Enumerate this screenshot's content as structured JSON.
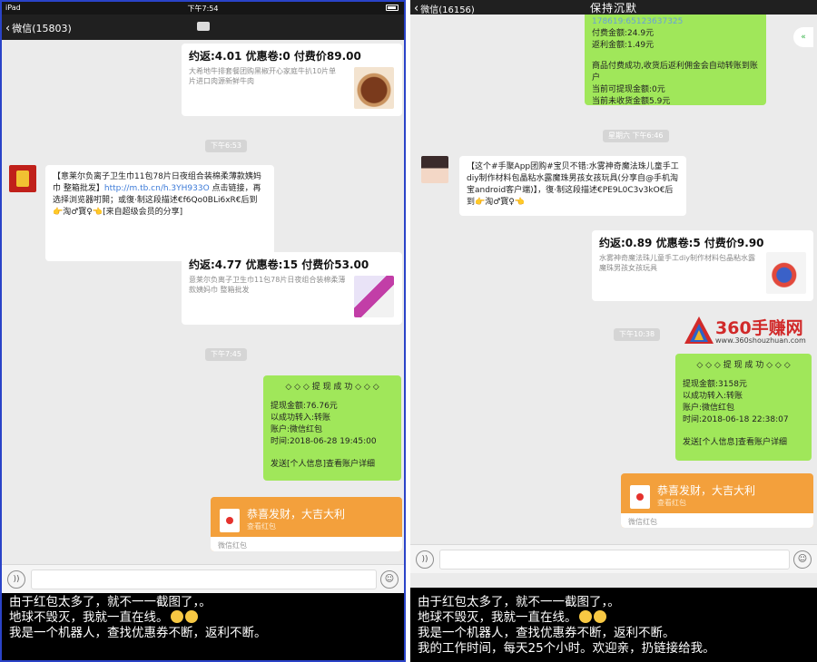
{
  "left": {
    "status": {
      "device": "iPad",
      "time": "下午7:54"
    },
    "nav": {
      "back_label": "微信(15803)"
    },
    "times": [
      "下午6:53",
      "下午7:45"
    ],
    "deal1": {
      "title": "约返:4.01 优惠卷:0 付费价89.00",
      "desc": "大希地牛排套餐团购黑椒开心家庭牛扒10片单片进口肉源新鲜牛肉"
    },
    "share1": {
      "text_a": "【意莱尔负离子卫生巾11包78片日夜组合装棉柔薄款姨妈巾 整箱批发】",
      "link": "http://m.tb.cn/h.3YH933O",
      "text_b": " 点击链接，再选择浏览器咑閞；或復·制这段描述€f6Qo0BLi6xR€后到👉淘♂寳♀👈[来自超级会员的分享]"
    },
    "deal2": {
      "title": "约返:4.77 优惠卷:15 付费价53.00",
      "desc": "意莱尔负离子卫生巾11包78片日夜组合装棉柔薄款姨妈巾 整箱批发"
    },
    "withdraw": {
      "header": "◇ ◇ ◇ 提 现 成 功 ◇ ◇ ◇",
      "amount": "提现金额:76.76元",
      "to": "以成功转入:转账",
      "account": "账户:微信红包",
      "time": "时间:2018-06-28 19:45:00",
      "footer": "发送[个人信息]查看账户详细"
    },
    "redpacket": {
      "title": "恭喜发财，大吉大利",
      "sub": "查看红包",
      "footer": "微信红包"
    },
    "caption": {
      "line1": "由于红包太多了，就不一一截图了，。",
      "line2": "地球不毁灭，我就一直在线。",
      "line3": "我是一个机器人，查找优惠券不断，返利不断。"
    }
  },
  "right": {
    "nav": {
      "back_label": "微信(16156)",
      "title": "保持沉默"
    },
    "side_badge": "«",
    "green_top": {
      "line0": "178619:65123637325",
      "line1": "付费金额:24.9元",
      "line2": "返利金额:1.49元",
      "line3": "商品付费成功,收货后返利佣金会自动转账到账户",
      "line4": "当前可提现金额:0元",
      "line5": "当前未收货金额5.9元"
    },
    "times": [
      "星期六 下午6:46",
      "下午10:38"
    ],
    "share": "【这个#手聚App团购#宝贝不错:水雾神奇魔法珠儿童手工diy制作材料包晶粘水露魔珠男孩女孩玩具(分享自@手机淘宝android客户端)】，復·制这段描述€PE9L0C3v3kO€后到👉淘♂寳♀👈",
    "deal": {
      "title": "约返:0.89 优惠卷:5 付费价9.90",
      "desc": "水雾神奇魔法珠儿童手工diy制作材料包晶粘水露魔珠男孩女孩玩具"
    },
    "withdraw": {
      "header": "◇ ◇ ◇ 提 现 成 功 ◇ ◇ ◇",
      "amount": "提现金额:3158元",
      "to": "以成功转入:转账",
      "account": "账户:微信红包",
      "time": "时间:2018-06-18 22:38:07",
      "footer": "发送[个人信息]查看账户详细"
    },
    "redpacket": {
      "title": "恭喜发财，大吉大利",
      "sub": "查看红包",
      "footer": "微信红包"
    },
    "caption": {
      "line1": "由于红包太多了，就不一一截图了，。",
      "line2": "地球不毁灭，我就一直在线。",
      "line3": "我是一个机器人，查找优惠券不断，返利不断。",
      "line4": "我的工作时间，每天25个小时。欢迎亲，扔链接给我。"
    }
  },
  "watermark": {
    "brand": "360手赚网",
    "url": "www.360shouzhuan.com"
  },
  "colors": {
    "wechat_green": "#a0e75a",
    "redpacket_orange": "#f3a03c",
    "frame_blue": "#2a43c8"
  }
}
